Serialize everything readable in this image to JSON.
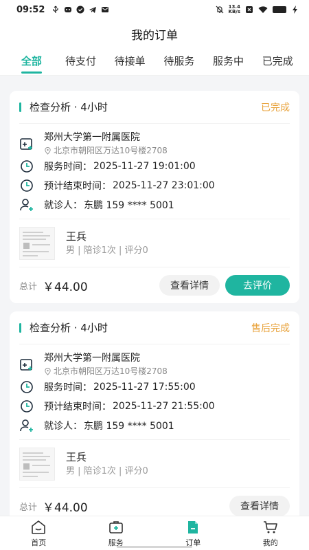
{
  "status_bar": {
    "time": "09:52",
    "net_speed_top": "13.4",
    "net_speed_bottom": "KB/s"
  },
  "header": {
    "title": "我的订单"
  },
  "tabs": [
    {
      "label": "全部",
      "active": true
    },
    {
      "label": "待支付",
      "active": false
    },
    {
      "label": "待接单",
      "active": false
    },
    {
      "label": "待服务",
      "active": false
    },
    {
      "label": "服务中",
      "active": false
    },
    {
      "label": "已完成",
      "active": false
    }
  ],
  "orders": [
    {
      "title": "检查分析 · 4小时",
      "status": "已完成",
      "hospital": "郑州大学第一附属医院",
      "address": "北京市朝阳区万达10号楼2708",
      "service_label": "服务时间：",
      "service_time": "2025-11-27 19:01:00",
      "end_label": "预计结束时间：",
      "end_time": "2025-11-27 23:01:00",
      "patient_label": "就诊人：",
      "patient": "东鹏 159 **** 5001",
      "escort_name": "王兵",
      "escort_meta": "男 | 陪诊1次 | 评分0",
      "total_label": "总计",
      "total": "￥44.00",
      "btn_detail": "查看详情",
      "btn_review": "去评价"
    },
    {
      "title": "检查分析 · 4小时",
      "status": "售后完成",
      "hospital": "郑州大学第一附属医院",
      "address": "北京市朝阳区万达10号楼2708",
      "service_label": "服务时间：",
      "service_time": "2025-11-27 17:55:00",
      "end_label": "预计结束时间：",
      "end_time": "2025-11-27 21:55:00",
      "patient_label": "就诊人：",
      "patient": "东鹏 159 **** 5001",
      "escort_name": "王兵",
      "escort_meta": "男 | 陪诊1次 | 评分0",
      "total_label": "总计",
      "total": "￥44.00",
      "btn_detail": "查看详情"
    }
  ],
  "tabbar": [
    {
      "label": "首页",
      "icon": "home-icon"
    },
    {
      "label": "服务",
      "icon": "medical-kit-icon"
    },
    {
      "label": "订单",
      "icon": "order-doc-icon",
      "active": true
    },
    {
      "label": "我的",
      "icon": "cart-icon"
    }
  ],
  "colors": {
    "accent": "#1fb5a0",
    "status_orange": "#e8a23a"
  }
}
